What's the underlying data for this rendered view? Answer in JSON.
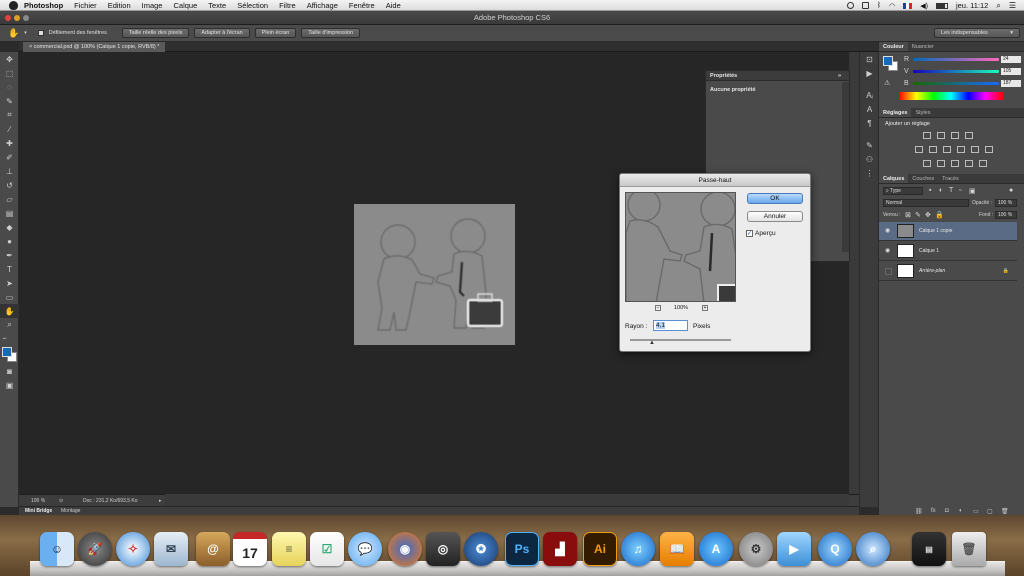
{
  "mac_menubar": {
    "app_name": "Photoshop",
    "menus": [
      "Fichier",
      "Edition",
      "Image",
      "Calque",
      "Texte",
      "Sélection",
      "Filtre",
      "Affichage",
      "Fenêtre",
      "Aide"
    ],
    "clock": "jeu. 11:12",
    "status_icons": [
      "record-icon",
      "dropbox-icon",
      "bluetooth-icon",
      "wifi-icon",
      "flag-fr-icon",
      "volume-icon",
      "battery-icon",
      "search-icon",
      "list-icon"
    ]
  },
  "window": {
    "title": "Adobe Photoshop CS6"
  },
  "options_bar": {
    "scroll_all_windows": "Défilement des fenêtres",
    "buttons": [
      "Taille réelle des pixels",
      "Adapter à l'écran",
      "Plein écran",
      "Taille d'impression"
    ],
    "workspace": "Les indispensables"
  },
  "document": {
    "tab_title": "commercial.psd @ 100% (Calque 1 copie, RVB/8) *",
    "zoom": "100 %",
    "doc_info": "Doc : 231,2 Ko/693,5 Ko"
  },
  "bottom_tabs": [
    "Mini Bridge",
    "Montage"
  ],
  "properties_panel": {
    "title": "Propriétés",
    "message": "Aucune propriété"
  },
  "color_panel": {
    "tabs": [
      "Couleur",
      "Nuancier"
    ],
    "channels": [
      {
        "label": "R",
        "value": "24"
      },
      {
        "label": "V",
        "value": "105"
      },
      {
        "label": "B",
        "value": "187"
      }
    ],
    "foreground_color": "#1869bb"
  },
  "adjustments_panel": {
    "tabs": [
      "Réglages",
      "Styles"
    ],
    "heading": "Ajouter un réglage"
  },
  "layers_panel": {
    "tabs": [
      "Calques",
      "Couches",
      "Tracés"
    ],
    "filter": "Type",
    "blend_mode": "Normal",
    "opacity_label": "Opacité :",
    "opacity": "100 %",
    "lock_label": "Verrou :",
    "fill_label": "Fond :",
    "fill": "100 %",
    "layers": [
      {
        "name": "Calque 1 copie",
        "selected": true
      },
      {
        "name": "Calque 1",
        "selected": false
      },
      {
        "name": "Arrière-plan",
        "selected": false
      }
    ]
  },
  "dialog": {
    "title": "Passe-haut",
    "ok": "OK",
    "cancel": "Annuler",
    "preview_label": "Aperçu",
    "preview_checked": true,
    "zoom": "100%",
    "radius_label": "Rayon :",
    "radius_value": "4,1",
    "radius_unit": "Pixels"
  },
  "dock": {
    "apps": [
      "Finder",
      "Launchpad",
      "Safari",
      "Mail",
      "Contacts",
      "Calendar",
      "Notes",
      "Rappels",
      "Messages",
      "Firefox",
      "Photo Booth",
      "Apercu",
      "Photoshop",
      "Flash",
      "Illustrator",
      "iTunes",
      "iBooks",
      "App Store",
      "Préférences Système",
      "FaceTime",
      "QuickTime",
      "Aperçu",
      "Documents",
      "Corbeille"
    ],
    "calendar_day": "17",
    "ps_label": "Ps",
    "ai_label": "Ai"
  }
}
